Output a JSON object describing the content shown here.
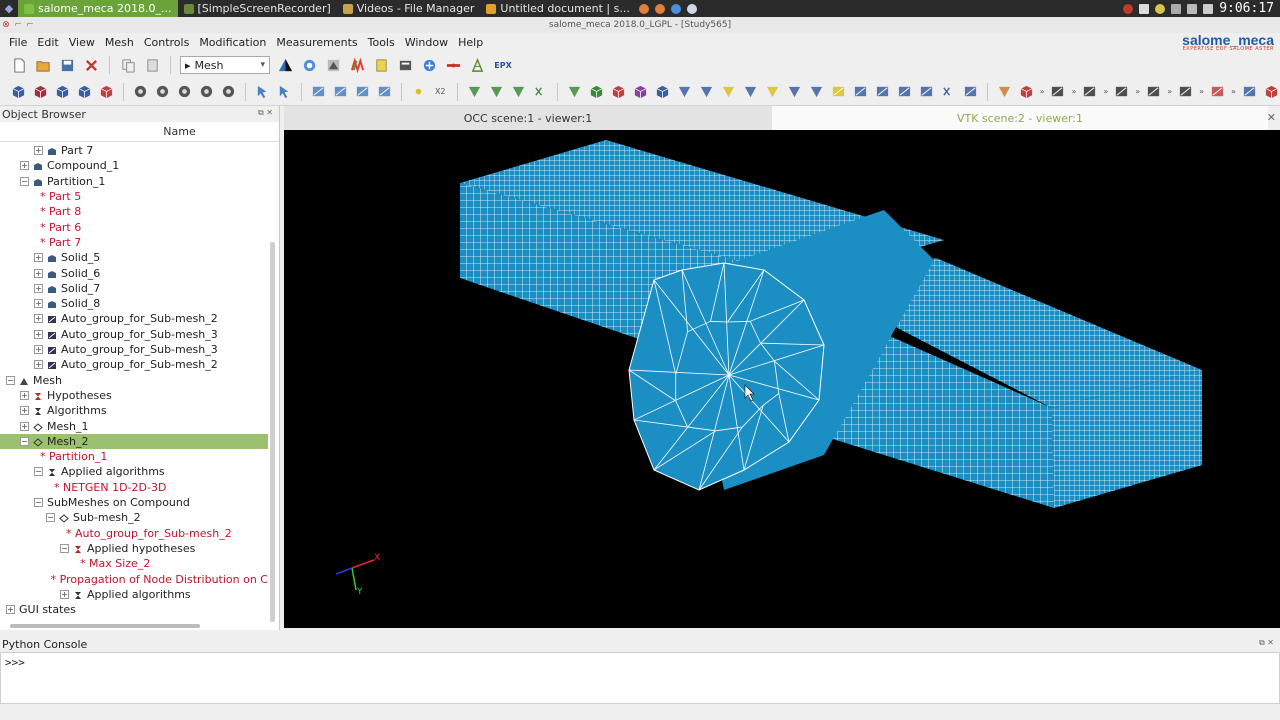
{
  "taskbar": {
    "tasks": [
      {
        "label": "salome_meca 2018.0_...",
        "active": true,
        "icon_color": "#7fc241"
      },
      {
        "label": "[SimpleScreenRecorder]",
        "active": false,
        "icon_color": "#6a8a3a"
      },
      {
        "label": "Videos - File Manager",
        "active": false,
        "icon_color": "#c8a24a"
      },
      {
        "label": "Untitled document | s...",
        "active": false,
        "icon_color": "#e0a030"
      }
    ],
    "clock": "9:06:17"
  },
  "window": {
    "title": "salome_meca 2018.0_LGPL - [Study565]"
  },
  "brand": {
    "name": "salome_meca",
    "tagline": "EXPERTISE EDF SALOME ASTER"
  },
  "menubar": {
    "items": [
      {
        "label": "File"
      },
      {
        "label": "Edit"
      },
      {
        "label": "View"
      },
      {
        "label": "Mesh"
      },
      {
        "label": "Controls"
      },
      {
        "label": "Modification"
      },
      {
        "label": "Measurements"
      },
      {
        "label": "Tools"
      },
      {
        "label": "Window"
      },
      {
        "label": "Help"
      }
    ]
  },
  "toolbar": {
    "module": "Mesh",
    "epx_label": "EPX",
    "x2_label": "X2"
  },
  "object_browser": {
    "title": "Object Browser",
    "column": "Name",
    "rows": [
      {
        "label": "Part 7",
        "expander": "+",
        "icon": "solid-icon",
        "red": false,
        "selected": false
      },
      {
        "label": "Compound_1",
        "expander": "+",
        "icon": "solid-icon",
        "red": false,
        "selected": false
      },
      {
        "label": "Partition_1",
        "expander": "-",
        "icon": "solid-icon",
        "red": false,
        "selected": false
      },
      {
        "label": "* Part 5",
        "expander": "",
        "icon": "",
        "red": true,
        "selected": false
      },
      {
        "label": "* Part 8",
        "expander": "",
        "icon": "",
        "red": true,
        "selected": false
      },
      {
        "label": "* Part 6",
        "expander": "",
        "icon": "",
        "red": true,
        "selected": false
      },
      {
        "label": "* Part 7",
        "expander": "",
        "icon": "",
        "red": true,
        "selected": false
      },
      {
        "label": "Solid_5",
        "expander": "+",
        "icon": "solid-icon",
        "red": false,
        "selected": false
      },
      {
        "label": "Solid_6",
        "expander": "+",
        "icon": "solid-icon",
        "red": false,
        "selected": false
      },
      {
        "label": "Solid_7",
        "expander": "+",
        "icon": "solid-icon",
        "red": false,
        "selected": false
      },
      {
        "label": "Solid_8",
        "expander": "+",
        "icon": "solid-icon",
        "red": false,
        "selected": false
      },
      {
        "label": "Auto_group_for_Sub-mesh_2",
        "expander": "+",
        "icon": "group-icon",
        "red": false,
        "selected": false
      },
      {
        "label": "Auto_group_for_Sub-mesh_3",
        "expander": "+",
        "icon": "group-icon",
        "red": false,
        "selected": false
      },
      {
        "label": "Auto_group_for_Sub-mesh_3",
        "expander": "+",
        "icon": "group-icon",
        "red": false,
        "selected": false
      },
      {
        "label": "Auto_group_for_Sub-mesh_2",
        "expander": "+",
        "icon": "group-icon",
        "red": false,
        "selected": false
      },
      {
        "label": "Mesh",
        "expander": "-",
        "icon": "mesh-module-icon",
        "red": false,
        "selected": false
      },
      {
        "label": "Hypotheses",
        "expander": "+",
        "icon": "hypothesis-icon",
        "red": false,
        "selected": false
      },
      {
        "label": "Algorithms",
        "expander": "+",
        "icon": "algorithm-icon",
        "red": false,
        "selected": false
      },
      {
        "label": "Mesh_1",
        "expander": "+",
        "icon": "mesh-icon",
        "red": false,
        "selected": false
      },
      {
        "label": "Mesh_2",
        "expander": "-",
        "icon": "mesh-icon",
        "red": false,
        "selected": true
      },
      {
        "label": "* Partition_1",
        "expander": "",
        "icon": "",
        "red": true,
        "selected": false
      },
      {
        "label": "Applied algorithms",
        "expander": "-",
        "icon": "algorithm-icon",
        "red": false,
        "selected": false
      },
      {
        "label": "* NETGEN 1D-2D-3D",
        "expander": "",
        "icon": "",
        "red": true,
        "selected": false
      },
      {
        "label": "SubMeshes on Compound",
        "expander": "-",
        "icon": "",
        "red": false,
        "selected": false
      },
      {
        "label": "Sub-mesh_2",
        "expander": "-",
        "icon": "mesh-icon",
        "red": false,
        "selected": false
      },
      {
        "label": "* Auto_group_for_Sub-mesh_2",
        "expander": "",
        "icon": "",
        "red": true,
        "selected": false
      },
      {
        "label": "Applied hypotheses",
        "expander": "-",
        "icon": "hypothesis-icon",
        "red": false,
        "selected": false
      },
      {
        "label": "* Max Size_2",
        "expander": "",
        "icon": "",
        "red": true,
        "selected": false
      },
      {
        "label": "* Propagation of Node Distribution on C",
        "expander": "",
        "icon": "",
        "red": true,
        "selected": false
      },
      {
        "label": "Applied algorithms",
        "expander": "+",
        "icon": "algorithm-icon",
        "red": false,
        "selected": false
      },
      {
        "label": "GUI states",
        "expander": "+",
        "icon": "",
        "red": false,
        "selected": false
      }
    ]
  },
  "viewer": {
    "tabs": [
      {
        "label": "OCC scene:1 - viewer:1"
      },
      {
        "label": "VTK scene:2 - viewer:1"
      }
    ],
    "mesh_color": "#1b8fc4",
    "axes": {
      "x": "X",
      "y": "Y"
    }
  },
  "console": {
    "title": "Python Console",
    "prompt": ">>>"
  }
}
